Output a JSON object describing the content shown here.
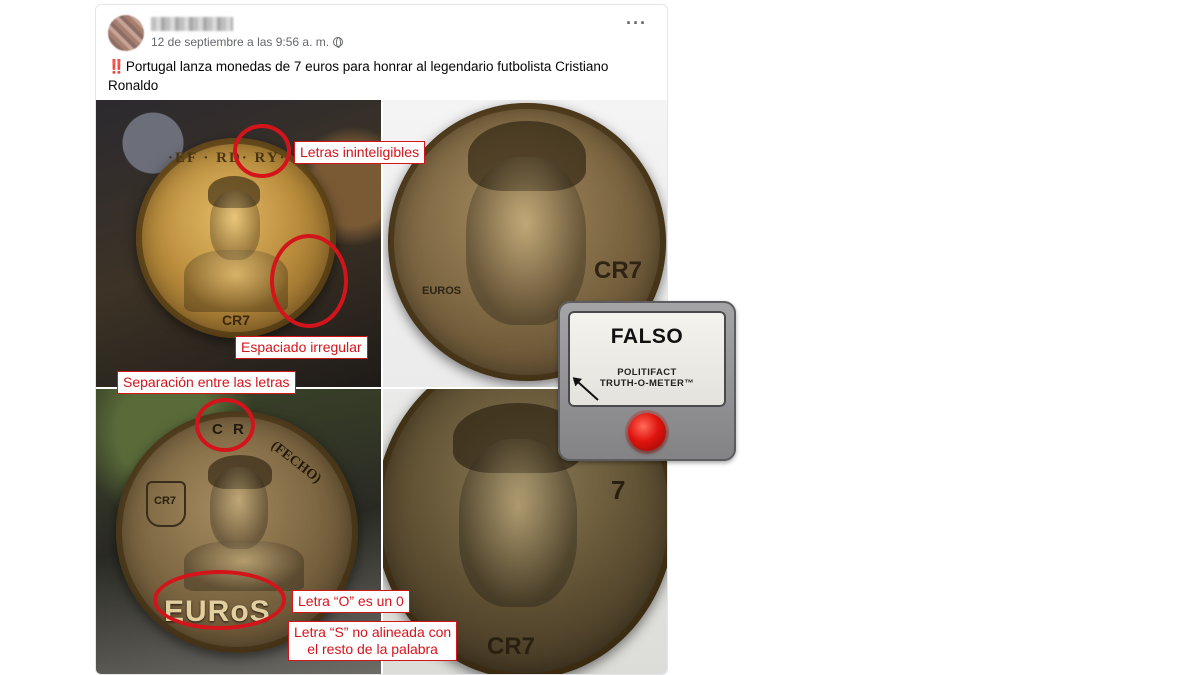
{
  "post": {
    "timestamp": "12 de septiembre a las 9:56 a. m.",
    "more_label": "···",
    "emoji_prefix": "‼️",
    "text": "Portugal lanza monedas de 7 euros para honrar al legendario futbolista Cristiano Ronaldo",
    "flag_icon": "portugal-flag-icon"
  },
  "coins": {
    "top_left": {
      "rim_top": "·EF · RD· RY·",
      "bottom": "CR7"
    },
    "top_right": {
      "right": "CR7",
      "left": "EUROS"
    },
    "bottom_left": {
      "top": "C R",
      "rim": "(FECHO)",
      "emblem": "CR7",
      "bottom": "EURoS"
    },
    "bottom_right": {
      "right": "7",
      "bottom": "CR7"
    }
  },
  "annotations": {
    "letras": "Letras ininteligibles",
    "espaciado": "Espaciado irregular",
    "separacion": "Separación entre las letras",
    "letra_o": "Letra “O” es un 0",
    "letra_s_line1": "Letra “S” no alineada con",
    "letra_s_line2": "el resto de la palabra"
  },
  "meter": {
    "verdict": "FALSO",
    "brand_line1": "POLITIFACT",
    "brand_line2": "TRUTH-O-METER™"
  },
  "colors": {
    "annotation_red": "#d4141b",
    "meter_button_red": "#e0140f"
  }
}
